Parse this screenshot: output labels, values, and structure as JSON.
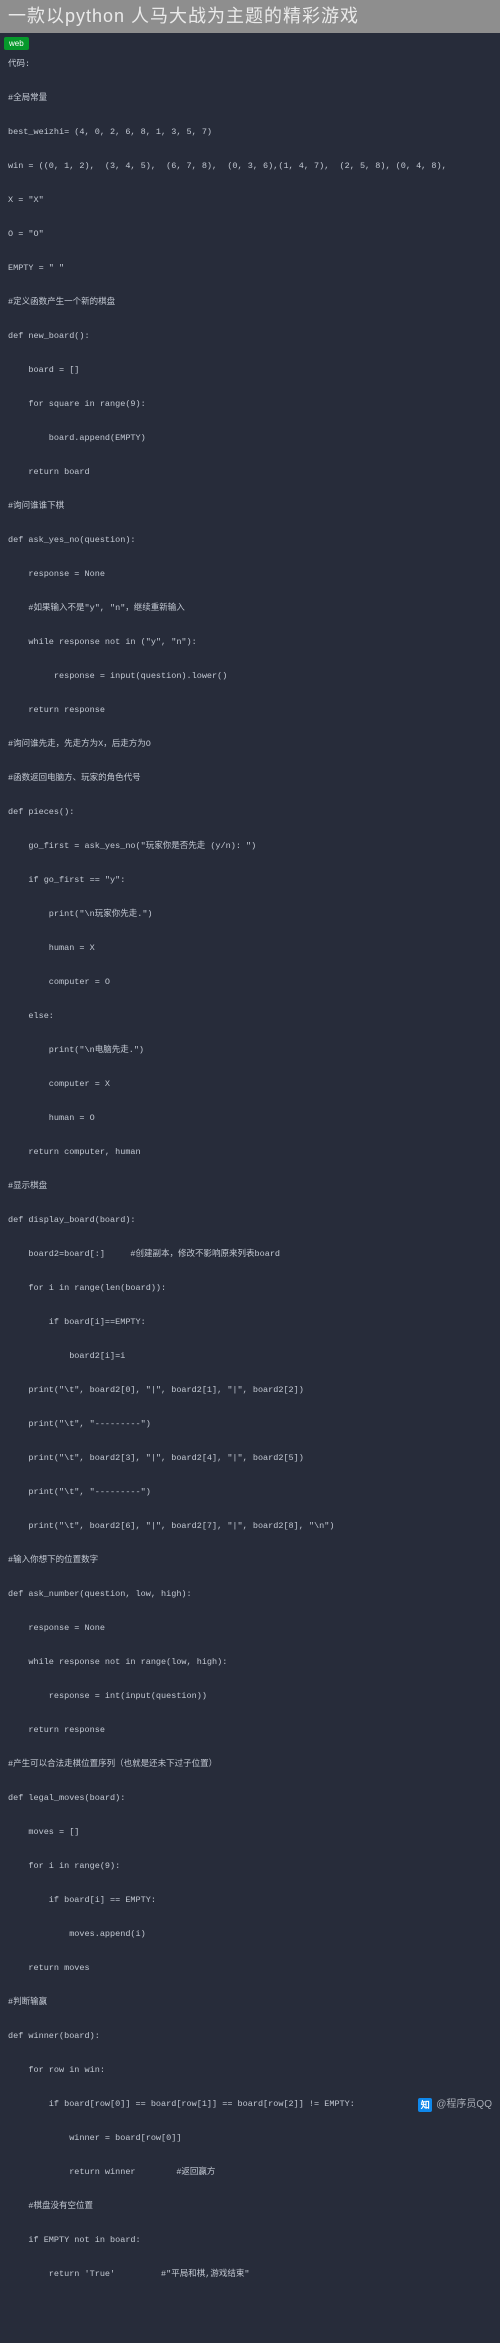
{
  "header": {
    "title": "一款以python 人马大战为主题的精彩游戏",
    "tag": "web"
  },
  "code": [
    "代码:",
    "",
    "#全局常量",
    "",
    "best_weizhi= (4, 0, 2, 6, 8, 1, 3, 5, 7)",
    "",
    "win = ((0, 1, 2),  (3, 4, 5),  (6, 7, 8),  (0, 3, 6),(1, 4, 7),  (2, 5, 8), (0, 4, 8),",
    "",
    "X = \"X\"",
    "",
    "O = \"O\"",
    "",
    "EMPTY = \" \"",
    "",
    "#定义函数产生一个新的棋盘",
    "",
    "def new_board():",
    "",
    "    board = []",
    "",
    "    for square in range(9):",
    "",
    "        board.append(EMPTY)",
    "",
    "    return board",
    "",
    "#询问谁谁下棋",
    "",
    "def ask_yes_no(question):",
    "",
    "    response = None",
    "",
    "    #如果输入不是\"y\", \"n\"，继续重新输入",
    "",
    "    while response not in (\"y\", \"n\"):",
    "",
    "         response = input(question).lower()",
    "",
    "    return response",
    "",
    "#询问谁先走，先走方为X，后走方为O",
    "",
    "#函数返回电脑方、玩家的角色代号",
    "",
    "def pieces():",
    "",
    "    go_first = ask_yes_no(\"玩家你是否先走 (y/n): \")",
    "",
    "    if go_first == \"y\":",
    "",
    "        print(\"\\n玩家你先走.\")",
    "",
    "        human = X",
    "",
    "        computer = O",
    "",
    "    else:",
    "",
    "        print(\"\\n电脑先走.\")",
    "",
    "        computer = X",
    "",
    "        human = O",
    "",
    "    return computer, human",
    "",
    "#显示棋盘",
    "",
    "def display_board(board):",
    "",
    "    board2=board[:]     #创建副本，修改不影响原来列表board",
    "",
    "    for i in range(len(board)):",
    "",
    "        if board[i]==EMPTY:",
    "",
    "            board2[i]=i",
    "",
    "    print(\"\\t\", board2[0], \"|\", board2[1], \"|\", board2[2])",
    "",
    "    print(\"\\t\", \"---------\")",
    "",
    "    print(\"\\t\", board2[3], \"|\", board2[4], \"|\", board2[5])",
    "",
    "    print(\"\\t\", \"---------\")",
    "",
    "    print(\"\\t\", board2[6], \"|\", board2[7], \"|\", board2[8], \"\\n\")",
    "",
    "#输入你想下的位置数字",
    "",
    "def ask_number(question, low, high):",
    "",
    "    response = None",
    "",
    "    while response not in range(low, high):",
    "",
    "        response = int(input(question))",
    "",
    "    return response",
    "",
    "#产生可以合法走棋位置序列（也就是还未下过子位置）",
    "",
    "def legal_moves(board):",
    "",
    "    moves = []",
    "",
    "    for i in range(9):",
    "",
    "        if board[i] == EMPTY:",
    "",
    "            moves.append(i)",
    "",
    "    return moves",
    "",
    "#判断输赢",
    "",
    "def winner(board):",
    "",
    "    for row in win:",
    "",
    "        if board[row[0]] == board[row[1]] == board[row[2]] != EMPTY:",
    "",
    "            winner = board[row[0]]",
    "",
    "            return winner        #返回赢方",
    "",
    "    #棋盘没有空位置",
    "",
    "    if EMPTY not in board:",
    "",
    "        return 'True'         #\"平局和棋,游戏结束\""
  ],
  "watermark": {
    "logo": "知",
    "text": "@程序员QQ"
  }
}
